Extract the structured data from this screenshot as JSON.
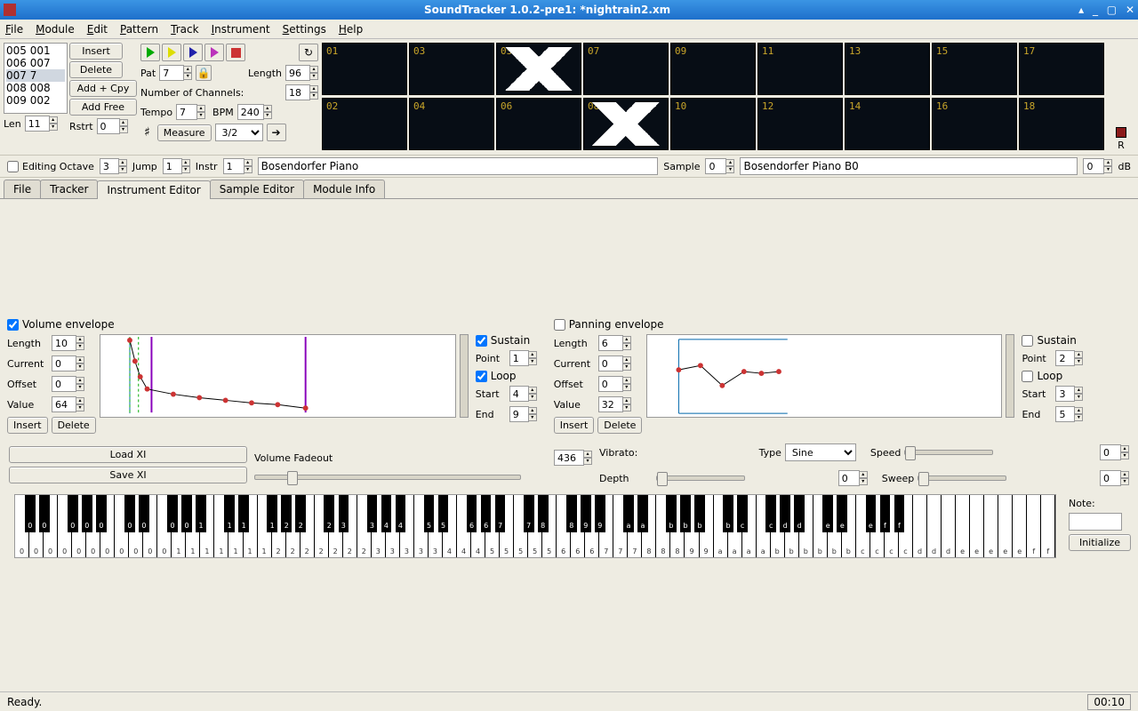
{
  "title": "SoundTracker 1.0.2-pre1: *nightrain2.xm",
  "menu": [
    "File",
    "Module",
    "Edit",
    "Pattern",
    "Track",
    "Instrument",
    "Settings",
    "Help"
  ],
  "seq_rows": [
    [
      "005",
      "001"
    ],
    [
      "006",
      "007"
    ],
    [
      "007",
      "7"
    ],
    [
      "008",
      "008"
    ],
    [
      "009",
      "002"
    ]
  ],
  "seq_sel_index": 2,
  "len_label": "Len",
  "len_val": "11",
  "btn_insert": "Insert",
  "btn_delete": "Delete",
  "btn_addcpy": "Add + Cpy",
  "btn_addfree": "Add Free",
  "rstrt_label": "Rstrt",
  "rstrt_val": "0",
  "pat_label": "Pat",
  "pat_val": "7",
  "length_label": "Length",
  "length_val": "96",
  "nchan_label": "Number of Channels:",
  "nchan_val": "18",
  "tempo_label": "Tempo",
  "tempo_val": "7",
  "bpm_label": "BPM",
  "bpm_val": "240",
  "measure_label": "Measure",
  "measure_val": "3/2",
  "editing_octave_label": "Editing Octave",
  "editing_octave_val": "3",
  "jump_label": "Jump",
  "jump_val": "1",
  "instr_label": "Instr",
  "instr_val": "1",
  "instr_name": "Bosendorfer Piano",
  "sample_label": "Sample",
  "sample_val": "0",
  "sample_name": "Bosendorfer Piano B0",
  "db_val": "0",
  "db_label": "dB",
  "r_label": "R",
  "scopes_top": [
    "01",
    "03",
    "05",
    "07",
    "09",
    "11",
    "13",
    "15",
    "17"
  ],
  "scopes_bot": [
    "02",
    "04",
    "06",
    "08",
    "10",
    "12",
    "14",
    "16",
    "18"
  ],
  "scope_active_top": 2,
  "scope_active_bot": 3,
  "tabs": [
    "File",
    "Tracker",
    "Instrument Editor",
    "Sample Editor",
    "Module Info"
  ],
  "tab_active": 2,
  "vol_env": {
    "title": "Volume envelope",
    "checked": true,
    "length_l": "Length",
    "length_v": "10",
    "current_l": "Current",
    "current_v": "0",
    "offset_l": "Offset",
    "offset_v": "0",
    "value_l": "Value",
    "value_v": "64",
    "insert": "Insert",
    "delete": "Delete",
    "sustain": "Sustain",
    "sustain_c": true,
    "point_l": "Point",
    "point_v": "1",
    "loop": "Loop",
    "loop_c": true,
    "start_l": "Start",
    "start_v": "4",
    "end_l": "End",
    "end_v": "9"
  },
  "pan_env": {
    "title": "Panning envelope",
    "checked": false,
    "length_l": "Length",
    "length_v": "6",
    "current_l": "Current",
    "current_v": "0",
    "offset_l": "Offset",
    "offset_v": "0",
    "value_l": "Value",
    "value_v": "32",
    "insert": "Insert",
    "delete": "Delete",
    "sustain": "Sustain",
    "sustain_c": false,
    "point_l": "Point",
    "point_v": "2",
    "loop": "Loop",
    "loop_c": false,
    "start_l": "Start",
    "start_v": "3",
    "end_l": "End",
    "end_v": "5"
  },
  "load_xi": "Load XI",
  "save_xi": "Save XI",
  "vol_fadeout_l": "Volume Fadeout",
  "vol_fadeout_v": "436",
  "vibrato_l": "Vibrato:",
  "type_l": "Type",
  "type_v": "Sine",
  "speed_l": "Speed",
  "speed_v": "0",
  "depth_l": "Depth",
  "depth_v": "0",
  "sweep_l": "Sweep",
  "sweep_v": "0",
  "note_l": "Note:",
  "initialize": "Initialize",
  "status": "Ready.",
  "time": "00:10",
  "keys_white": [
    "0",
    "0",
    "0",
    "0",
    "0",
    "0",
    "0",
    "0",
    "0",
    "0",
    "0",
    "1",
    "1",
    "1",
    "1",
    "1",
    "1",
    "1",
    "2",
    "2",
    "2",
    "2",
    "2",
    "2",
    "2",
    "3",
    "3",
    "3",
    "3",
    "3",
    "4",
    "4",
    "4",
    "5",
    "5",
    "5",
    "5",
    "5",
    "6",
    "6",
    "6",
    "7",
    "7",
    "7",
    "8",
    "8",
    "8",
    "9",
    "9",
    "a",
    "a",
    "a",
    "a",
    "b",
    "b",
    "b",
    "b",
    "b",
    "b",
    "c",
    "c",
    "c",
    "c",
    "d",
    "d",
    "d",
    "e",
    "e",
    "e",
    "e",
    "e",
    "f",
    "f"
  ],
  "keys_black": [
    "0",
    "0",
    "0",
    "0",
    "0",
    "0",
    "0",
    "0",
    "0",
    "1",
    "1",
    "1",
    "1",
    "2",
    "2",
    "2",
    "3",
    "3",
    "4",
    "4",
    "5",
    "5",
    "6",
    "6",
    "7",
    "7",
    "8",
    "8",
    "9",
    "9",
    "a",
    "a",
    "b",
    "b",
    "b",
    "b",
    "c",
    "c",
    "d",
    "d",
    "e",
    "e",
    "e",
    "f",
    "f"
  ],
  "chart_data": [
    {
      "type": "line",
      "title": "Volume envelope",
      "xlim": [
        0,
        216
      ],
      "ylim": [
        0,
        64
      ],
      "series": [
        {
          "name": "volume",
          "points": [
            [
              0,
              64
            ],
            [
              8,
              45
            ],
            [
              16,
              32
            ],
            [
              24,
              19
            ],
            [
              48,
              15
            ],
            [
              80,
              12
            ],
            [
              112,
              10
            ],
            [
              144,
              8
            ],
            [
              176,
              6
            ],
            [
              216,
              3
            ]
          ]
        }
      ],
      "markers": {
        "sustain": 12,
        "loop_start": 24,
        "loop_end": 216,
        "current": 24
      }
    },
    {
      "type": "line",
      "title": "Panning envelope",
      "xlim": [
        0,
        128
      ],
      "ylim": [
        0,
        64
      ],
      "series": [
        {
          "name": "panning",
          "points": [
            [
              0,
              32
            ],
            [
              20,
              36
            ],
            [
              42,
              22
            ],
            [
              68,
              34
            ],
            [
              90,
              33
            ],
            [
              110,
              34
            ]
          ]
        }
      ],
      "markers": {
        "current": 0
      }
    }
  ]
}
